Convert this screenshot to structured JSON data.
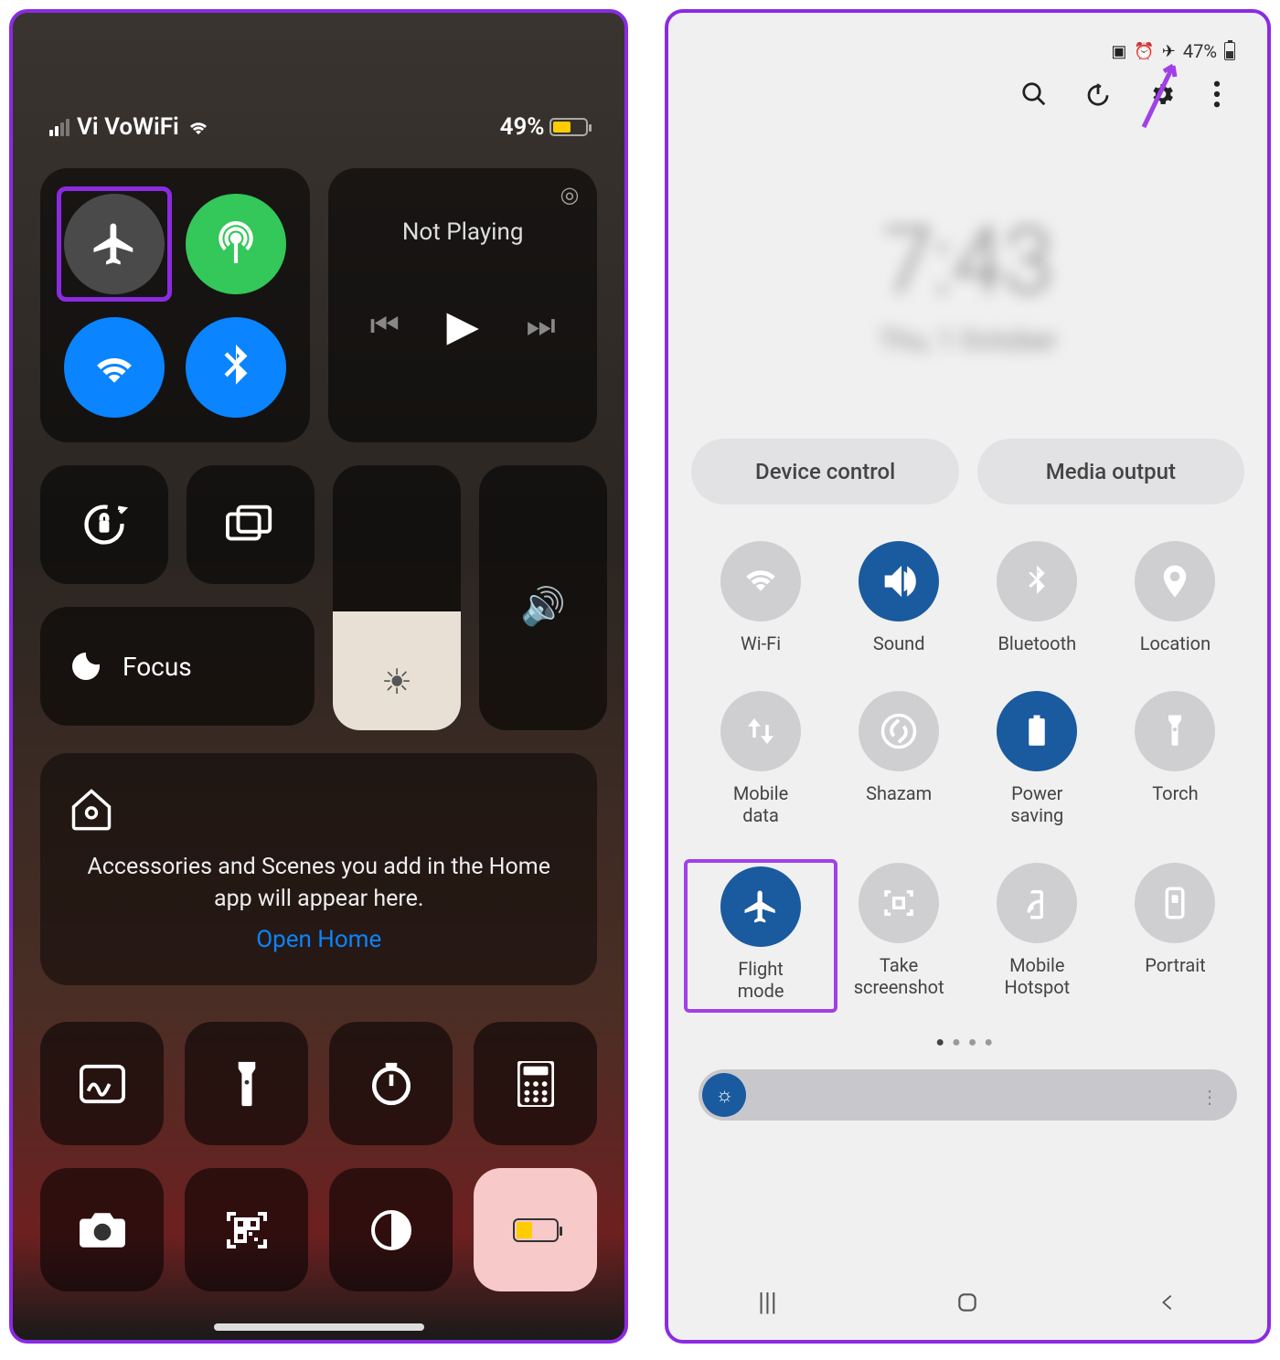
{
  "ios": {
    "status": {
      "carrier": "Vi VoWiFi",
      "battery_pct": "49%"
    },
    "media": {
      "title": "Not Playing"
    },
    "focus": {
      "label": "Focus"
    },
    "home": {
      "text": "Accessories and Scenes you add in the Home app will appear here.",
      "link": "Open Home"
    }
  },
  "android": {
    "status": {
      "battery_pct": "47%"
    },
    "clock": {
      "time": "7:43",
      "date": "Thu, 1 October"
    },
    "pills": {
      "device": "Device control",
      "media": "Media output"
    },
    "tiles": [
      {
        "label": "Wi-Fi",
        "icon": "wifi",
        "active": false
      },
      {
        "label": "Sound",
        "icon": "sound",
        "active": true
      },
      {
        "label": "Bluetooth",
        "icon": "bluetooth",
        "active": false
      },
      {
        "label": "Location",
        "icon": "location",
        "active": false
      },
      {
        "label": "Mobile data",
        "icon": "mobiledata",
        "active": false
      },
      {
        "label": "Shazam",
        "icon": "shazam",
        "active": false
      },
      {
        "label": "Power saving",
        "icon": "powersave",
        "active": true
      },
      {
        "label": "Torch",
        "icon": "torch",
        "active": false
      },
      {
        "label": "Flight mode",
        "icon": "flight",
        "active": true,
        "highlight": true
      },
      {
        "label": "Take screenshot",
        "icon": "screenshot",
        "active": false
      },
      {
        "label": "Mobile Hotspot",
        "icon": "hotspot",
        "active": false
      },
      {
        "label": "Portrait",
        "icon": "portrait",
        "active": false
      }
    ]
  }
}
